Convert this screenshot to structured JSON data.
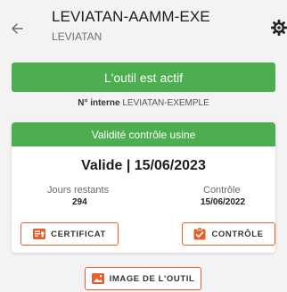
{
  "header": {
    "title": "LEVIATAN-AAMM-EXE",
    "subtitle": "LEVIATAN",
    "back_icon": "arrow-left-icon",
    "settings_icon": "gear-icon"
  },
  "status": {
    "active_label": "L'outil est actif",
    "internal_prefix": "N° interne",
    "internal_value": "LEVIATAN-EXEMPLE"
  },
  "validity_card": {
    "header": "Validité contrôle usine",
    "status_line": "Valide | 15/06/2023",
    "remaining_label": "Jours restants",
    "remaining_value": "294",
    "control_label": "Contrôle",
    "control_value": "15/06/2022",
    "certificate_button": "CERTIFICAT",
    "control_button": "CONTRÔLE"
  },
  "image_button": "IMAGE DE L'OUTIL",
  "colors": {
    "green": "#4cae50",
    "orange": "#e3602b",
    "background": "#f3f3f3"
  }
}
